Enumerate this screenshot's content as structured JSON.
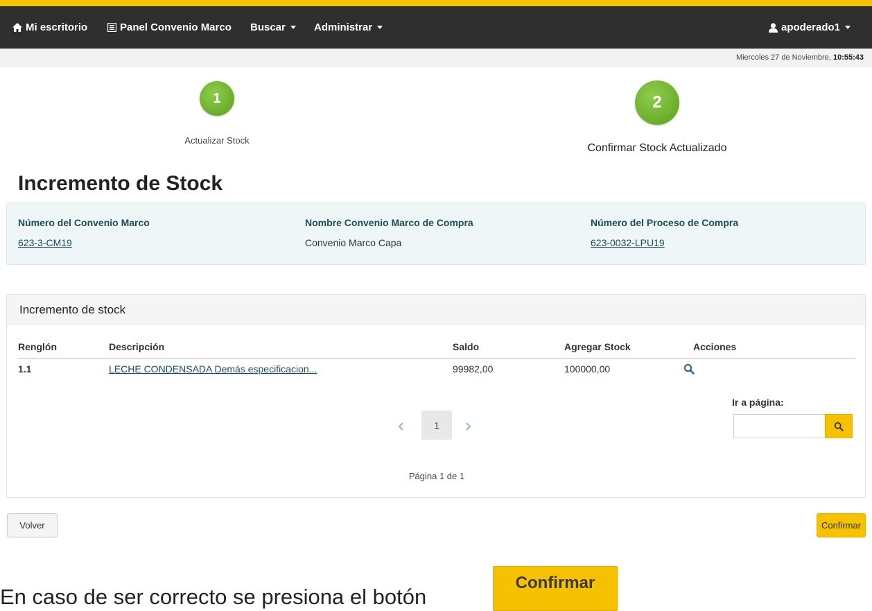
{
  "colors": {
    "accent": "#f5c100",
    "navbar": "#2f2f2f",
    "step": "#6aad2a",
    "info_panel": "#eef6f7",
    "link": "#1e4a55"
  },
  "nav": {
    "items": [
      {
        "label": "Mi escritorio",
        "icon": "home-icon"
      },
      {
        "label": "Panel Convenio Marco",
        "icon": "list-icon"
      },
      {
        "label": "Buscar",
        "icon": "chevron-down-icon"
      },
      {
        "label": "Administrar",
        "icon": "chevron-down-icon"
      }
    ],
    "user": {
      "label": "apoderado1",
      "icon": "user-icon"
    }
  },
  "datebar": {
    "date": "Miercoles 27 de Noviembre, ",
    "time": "10:55:43"
  },
  "steps": [
    {
      "number": "1",
      "label": "Actualizar Stock"
    },
    {
      "number": "2",
      "label": "Confirmar Stock Actualizado"
    }
  ],
  "page_title": "Incremento de Stock",
  "info": {
    "convenio_label": "Número del Convenio Marco",
    "convenio_value": "623-3-CM19",
    "nombre_label": "Nombre Convenio Marco de Compra",
    "nombre_value": "Convenio Marco Capa",
    "proceso_label": "Número del Proceso de Compra",
    "proceso_value": "623-0032-LPU19"
  },
  "stock_panel": {
    "title": "Incremento de stock",
    "columns": [
      "Renglón",
      "Descripción",
      "Saldo",
      "Agregar Stock",
      "Acciones"
    ],
    "rows": [
      {
        "renglon": "1.1",
        "descripcion": "LECHE CONDENSADA Demás especificacion...",
        "saldo": "99982,00",
        "agregar": "100000,00",
        "action_icon": "search-icon"
      }
    ],
    "pagination": {
      "prev_icon": "chevron-left-icon",
      "current": "1",
      "next_icon": "chevron-right-icon",
      "info": "Página 1 de 1"
    },
    "goto": {
      "label": "Ir a página:",
      "value": "",
      "button_icon": "search-icon"
    }
  },
  "buttons": {
    "back": "Volver",
    "confirm": "Confirmar"
  },
  "caption": {
    "text": "En caso de ser correcto se presiona el botón",
    "button": "Confirmar"
  }
}
